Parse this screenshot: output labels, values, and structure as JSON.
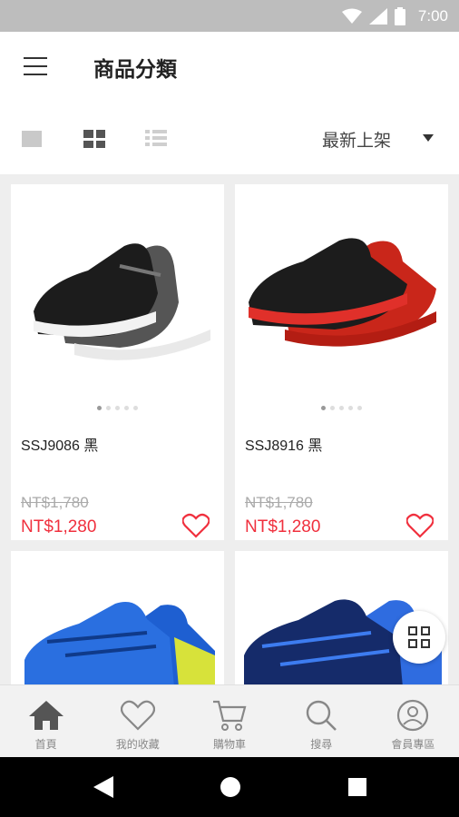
{
  "status_bar": {
    "time": "7:00"
  },
  "header": {
    "title": "商品分類"
  },
  "toolbar": {
    "sort_label": "最新上架"
  },
  "products": [
    {
      "name": "SSJ9086 黑",
      "original_price": "NT$1,780",
      "sale_price": "NT$1,280",
      "image_colors": [
        "#1a1a1a",
        "#9a9a9a"
      ]
    },
    {
      "name": "SSJ8916 黑",
      "original_price": "NT$1,780",
      "sale_price": "NT$1,280",
      "image_colors": [
        "#1a1a1a",
        "#d62b1d"
      ]
    },
    {
      "name": "",
      "original_price": "",
      "sale_price": "",
      "image_colors": [
        "#1e5fd1",
        "#d7e23a"
      ]
    },
    {
      "name": "",
      "original_price": "",
      "sale_price": "",
      "image_colors": [
        "#152b6a",
        "#2f6ce0"
      ]
    }
  ],
  "tabs": [
    {
      "label": "首頁",
      "icon": "home-icon"
    },
    {
      "label": "我的收藏",
      "icon": "heart-icon"
    },
    {
      "label": "購物車",
      "icon": "cart-icon"
    },
    {
      "label": "搜尋",
      "icon": "search-icon"
    },
    {
      "label": "會員專區",
      "icon": "member-icon"
    }
  ],
  "colors": {
    "price_red": "#f0303e",
    "tab_active": "#555555"
  }
}
